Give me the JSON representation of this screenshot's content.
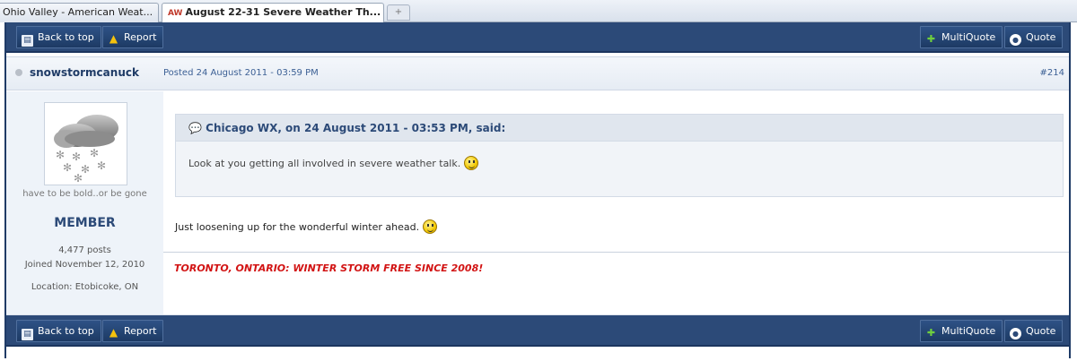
{
  "browser": {
    "tabs": [
      {
        "label": "Ohio Valley - American Weat...",
        "close": "×"
      },
      {
        "favicon": "AW",
        "label": "August 22-31 Severe Weather Th...",
        "close": "×"
      }
    ],
    "new_tab": "+"
  },
  "toolbar": {
    "back_to_top": "Back to top",
    "report": "Report",
    "multiquote": "MultiQuote",
    "quote": "Quote"
  },
  "post": {
    "username": "snowstormcanuck",
    "posted": "Posted 24 August 2011 - 03:59 PM",
    "number": "#214",
    "quote_citation": "Chicago WX, on 24 August 2011 - 03:53 PM, said:",
    "quote_text": "Look at you getting all involved in severe weather talk.",
    "body": "Just loosening up for the wonderful winter ahead.",
    "signature": "TORONTO, ONTARIO: WINTER STORM FREE SINCE 2008!"
  },
  "author": {
    "tagline": "have to be bold..or be gone",
    "rank": "MEMBER",
    "posts": "4,477 posts",
    "joined": "Joined November 12, 2010",
    "location": "Location: Etobicoke, ON"
  },
  "colors": {
    "bar": "#2c4a78",
    "rank": "#2c4a78",
    "signature": "#d21414"
  }
}
